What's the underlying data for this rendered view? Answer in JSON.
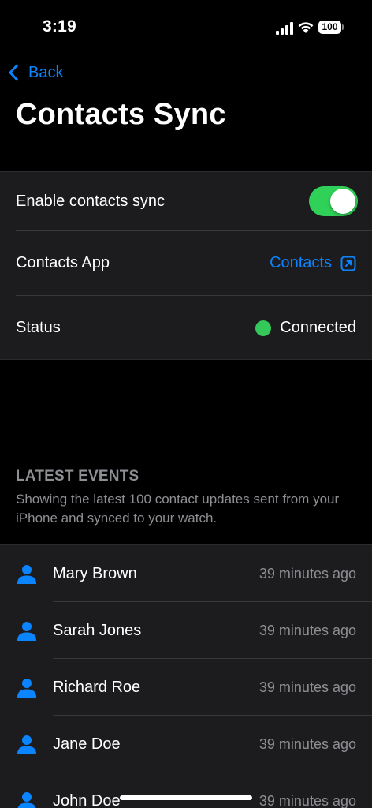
{
  "status_bar": {
    "time": "3:19",
    "battery": "100",
    "icons": [
      "signal-icon",
      "wifi-icon",
      "battery-icon"
    ]
  },
  "nav": {
    "back_label": "Back",
    "title": "Contacts Sync"
  },
  "settings": {
    "enable_sync": {
      "label": "Enable contacts sync",
      "enabled": true
    },
    "contacts_app": {
      "label": "Contacts App",
      "link_label": "Contacts",
      "icon": "external-link-icon"
    },
    "status": {
      "label": "Status",
      "value": "Connected",
      "indicator_color": "#34c759"
    }
  },
  "latest_events": {
    "header": "LATEST EVENTS",
    "description": "Showing the latest 100 contact updates sent from your iPhone and synced to your watch.",
    "items": [
      {
        "name": "Mary Brown",
        "time": "39 minutes ago"
      },
      {
        "name": "Sarah Jones",
        "time": "39 minutes ago"
      },
      {
        "name": "Richard Roe",
        "time": "39 minutes ago"
      },
      {
        "name": "Jane Doe",
        "time": "39 minutes ago"
      },
      {
        "name": "John Doe",
        "time": "39 minutes ago"
      }
    ]
  },
  "colors": {
    "accent": "#0a84ff",
    "toggle_on": "#30d158",
    "background": "#000000",
    "group_background": "#1c1c1e",
    "secondary_text": "#8e8e93"
  }
}
